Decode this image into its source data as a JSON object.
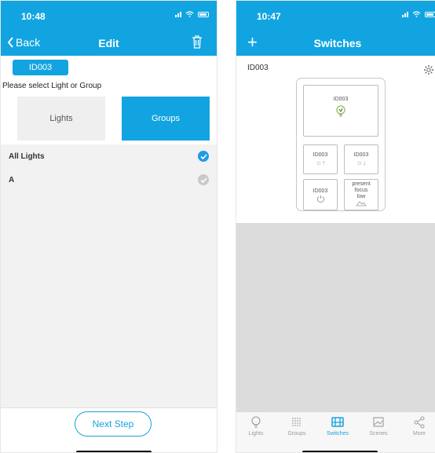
{
  "left": {
    "status": {
      "time": "10:48"
    },
    "nav": {
      "back": "Back",
      "title": "Edit"
    },
    "device_chip": "ID003",
    "prompt": "Please select Light or Group",
    "segments": {
      "lights": "Lights",
      "groups": "Groups"
    },
    "list": [
      {
        "label": "All Lights",
        "checked": true
      },
      {
        "label": "A",
        "checked": false
      }
    ],
    "next_button": "Next Step"
  },
  "right": {
    "status": {
      "time": "10:47"
    },
    "nav": {
      "title": "Switches"
    },
    "device_label": "ID003",
    "panel": {
      "top_button": "ID003",
      "brighter": "ID003",
      "dimmer": "ID003",
      "power": "ID003",
      "scene": [
        "present",
        "focus",
        "low"
      ]
    },
    "tabs": [
      {
        "label": "Lights",
        "icon": "bulb-icon"
      },
      {
        "label": "Groups",
        "icon": "groups-icon"
      },
      {
        "label": "Switches",
        "icon": "switches-icon",
        "active": true
      },
      {
        "label": "Scenes",
        "icon": "scenes-icon"
      },
      {
        "label": "More",
        "icon": "share-icon"
      }
    ]
  },
  "colors": {
    "accent": "#12a4e0",
    "check_on": "#1e9be9",
    "check_off": "#c9c9c9"
  }
}
